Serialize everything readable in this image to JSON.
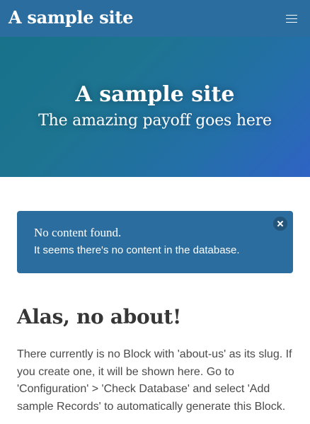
{
  "navbar": {
    "brand": "A sample site",
    "menu_icon": "hamburger-menu-icon"
  },
  "hero": {
    "title": "A sample site",
    "subtitle": "The amazing payoff goes here"
  },
  "notice": {
    "title": "No content found.",
    "message": "It seems there's no content in the database.",
    "close_icon": "close-icon"
  },
  "main": {
    "heading": "Alas, no about!",
    "body": "There currently is no Block with 'about-us' as its slug. If you create one, it will be shown here. Go to 'Configuration' > 'Check Database' and select 'Add sample Records' to automatically generate this Block."
  },
  "colors": {
    "navbar": "#2b6d9f",
    "hero_start": "#17728a",
    "hero_end": "#2f63c4",
    "notice": "#2b6d9f",
    "heading": "#363636",
    "body_text": "#4a4a4a"
  }
}
